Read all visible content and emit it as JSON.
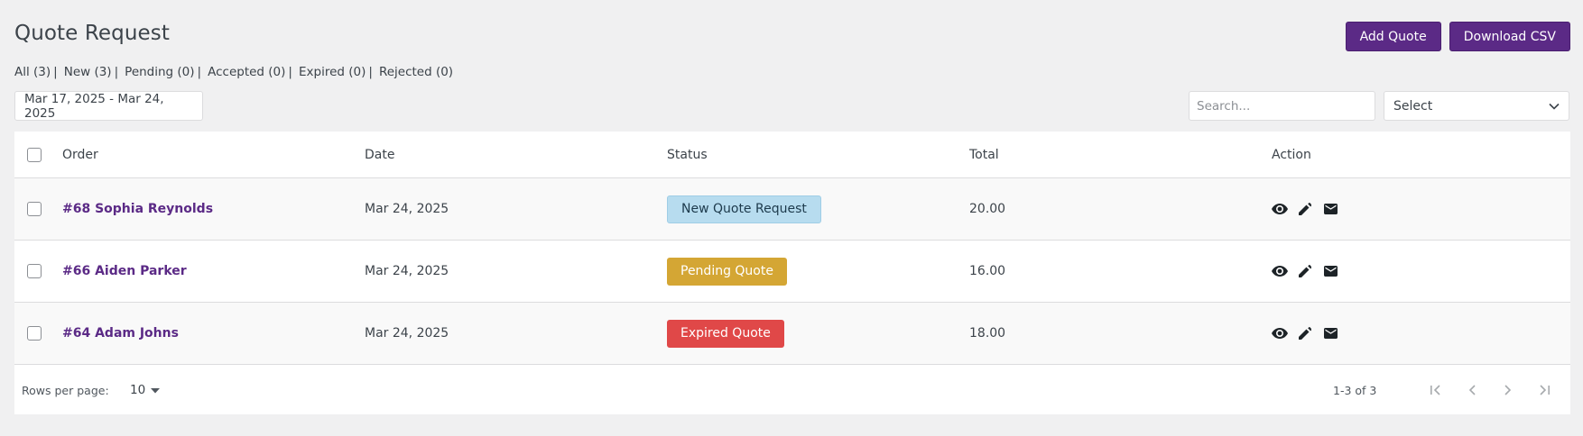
{
  "page": {
    "title": "Quote Request"
  },
  "toolbar": {
    "add_label": "Add Quote",
    "download_label": "Download CSV"
  },
  "filters": [
    {
      "label": "All (3)"
    },
    {
      "label": "New (3)"
    },
    {
      "label": "Pending (0)"
    },
    {
      "label": "Accepted (0)"
    },
    {
      "label": "Expired (0)"
    },
    {
      "label": "Rejected (0)"
    }
  ],
  "filter_separator": "|",
  "date_range": {
    "value": "Mar 17, 2025 - Mar 24, 2025"
  },
  "search": {
    "placeholder": "Search...",
    "value": ""
  },
  "select": {
    "value": "Select"
  },
  "table": {
    "headers": {
      "order": "Order",
      "date": "Date",
      "status": "Status",
      "total": "Total",
      "action": "Action"
    },
    "rows": [
      {
        "order": "#68 Sophia Reynolds",
        "date": "Mar 24, 2025",
        "status": "New Quote Request",
        "total": "20.00"
      },
      {
        "order": "#66 Aiden Parker",
        "date": "Mar 24, 2025",
        "status": "Pending Quote",
        "total": "16.00"
      },
      {
        "order": "#64 Adam Johns",
        "date": "Mar 24, 2025",
        "status": "Expired Quote",
        "total": "18.00"
      }
    ],
    "action_icons": [
      "eye-icon",
      "pencil-icon",
      "envelope-icon"
    ]
  },
  "pagination": {
    "rows_per_page_label": "Rows per page:",
    "rows_per_page_value": "10",
    "range": "1-3 of 3",
    "icons": [
      "first-page-icon",
      "prev-page-icon",
      "next-page-icon",
      "last-page-icon"
    ]
  },
  "colors": {
    "brand": "#5b2a86",
    "status_new": "#b7dcef",
    "status_pending": "#d4a634",
    "status_expired": "#e04848"
  }
}
